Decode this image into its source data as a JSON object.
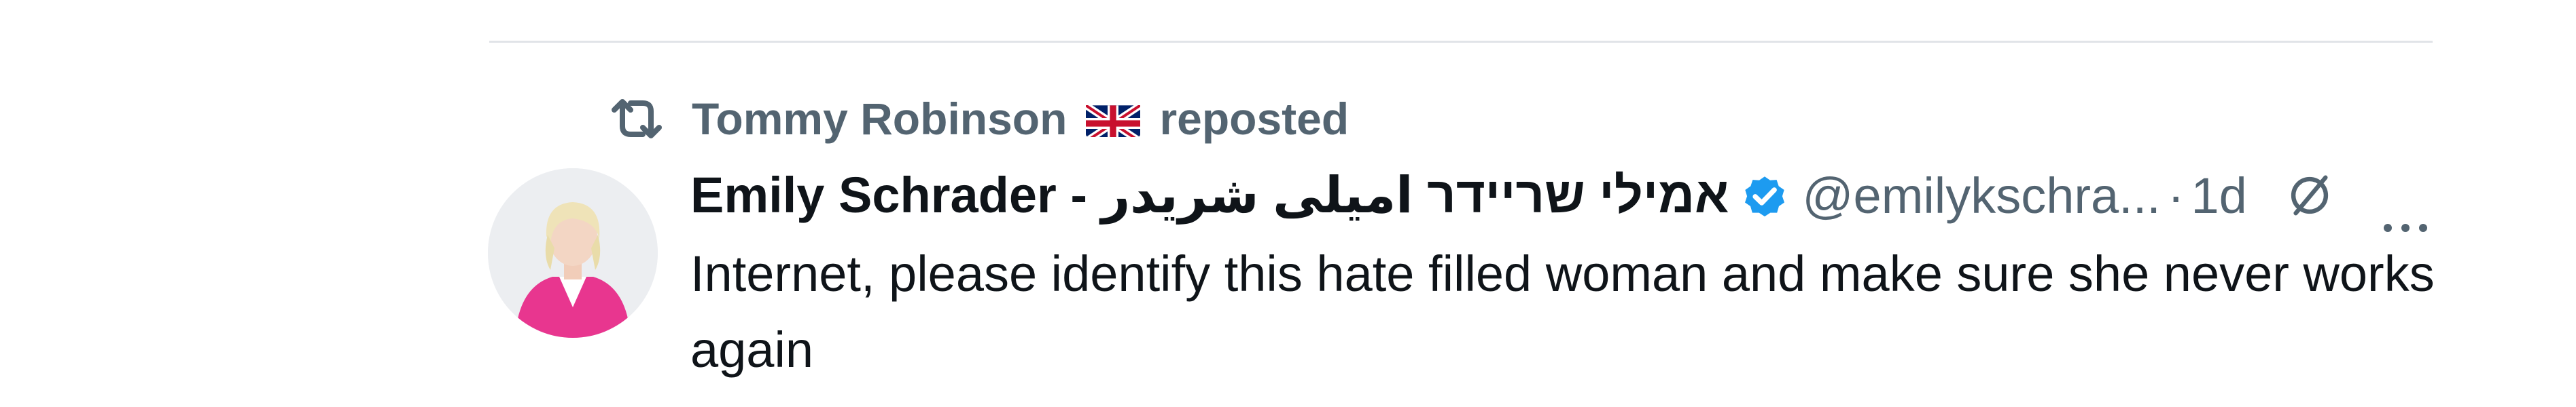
{
  "repost": {
    "user_name": "Tommy Robinson",
    "flag_icon": "uk-flag-icon",
    "label": "reposted"
  },
  "tweet": {
    "display_name": "Emily Schrader - אמילי שריידר اميلى شريدر",
    "verified_icon": "verified-badge-icon",
    "handle": "@emilykschra...",
    "separator": "·",
    "time": "1d",
    "text": "Internet, please identify this hate filled woman and make sure she never works again"
  },
  "icons": {
    "repost": "repost-icon",
    "grok": "grok-icon",
    "more": "more-options-icon"
  },
  "colors": {
    "secondary_text": "#536471",
    "primary_text": "#0f1419",
    "verified_blue": "#1d9bf0",
    "divider": "#e1e4e8"
  }
}
